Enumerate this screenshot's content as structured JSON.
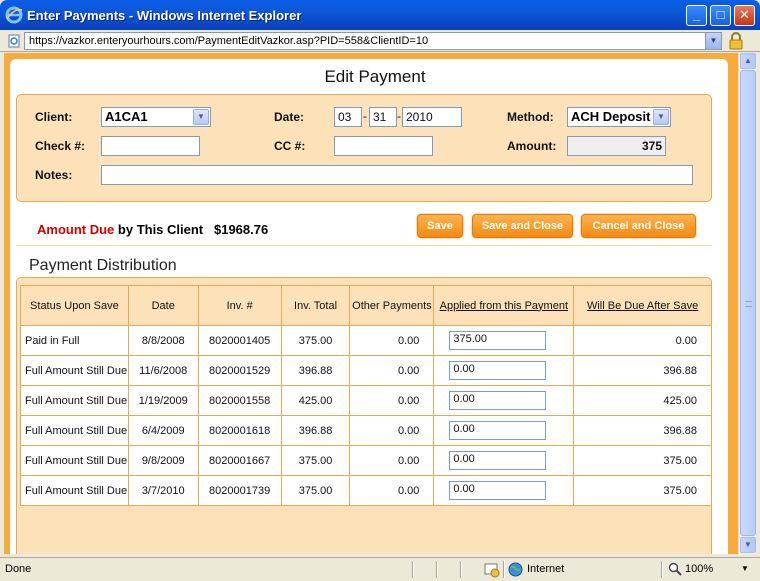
{
  "window": {
    "title": "Enter Payments - Windows Internet Explorer",
    "minimize": "_",
    "maximize": "□",
    "close": "✕"
  },
  "address": {
    "url": "https://vazkor.enteryourhours.com/PaymentEditVazkor.asp?PID=558&ClientID=10"
  },
  "form": {
    "heading": "Edit Payment",
    "client_label": "Client:",
    "client_value": "A1CA1",
    "date_label": "Date:",
    "date_month": "03",
    "date_day": "31",
    "date_year": "2010",
    "date_sep": "-",
    "method_label": "Method:",
    "method_value": "ACH Deposit",
    "check_label": "Check #:",
    "check_value": "",
    "cc_label": "CC #:",
    "cc_value": "",
    "amount_label": "Amount:",
    "amount_value": "375",
    "notes_label": "Notes:",
    "notes_value": ""
  },
  "summary": {
    "amount_due_label": "Amount Due",
    "by_client_label": "by This Client",
    "amount_due_value": "$1968.76"
  },
  "buttons": {
    "save": "Save",
    "save_close": "Save and Close",
    "cancel_close": "Cancel and Close"
  },
  "distribution": {
    "title": "Payment Distribution",
    "headers": [
      "Status Upon Save",
      "Date",
      "Inv. #",
      "Inv. Total",
      "Other Payments",
      "Applied from this Payment",
      "Will Be Due After Save"
    ],
    "rows": [
      {
        "status": "Paid in Full",
        "date": "8/8/2008",
        "inv": "8020001405",
        "total": "375.00",
        "other": "0.00",
        "applied": "375.00",
        "due": "0.00"
      },
      {
        "status": "Full Amount Still Due",
        "date": "11/6/2008",
        "inv": "8020001529",
        "total": "396.88",
        "other": "0.00",
        "applied": "0.00",
        "due": "396.88"
      },
      {
        "status": "Full Amount Still Due",
        "date": "1/19/2009",
        "inv": "8020001558",
        "total": "425.00",
        "other": "0.00",
        "applied": "0.00",
        "due": "425.00"
      },
      {
        "status": "Full Amount Still Due",
        "date": "6/4/2009",
        "inv": "8020001618",
        "total": "396.88",
        "other": "0.00",
        "applied": "0.00",
        "due": "396.88"
      },
      {
        "status": "Full Amount Still Due",
        "date": "9/8/2009",
        "inv": "8020001667",
        "total": "375.00",
        "other": "0.00",
        "applied": "0.00",
        "due": "375.00"
      },
      {
        "status": "Full Amount Still Due",
        "date": "3/7/2010",
        "inv": "8020001739",
        "total": "375.00",
        "other": "0.00",
        "applied": "0.00",
        "due": "375.00"
      }
    ]
  },
  "status": {
    "left": "Done",
    "zone": "Internet",
    "zoom": "100%"
  },
  "colors": {
    "page_frame": "#f7ab3d",
    "panel": "#fde2b9",
    "accent_red": "#d40000",
    "accent_green": "#1a7c1a"
  }
}
